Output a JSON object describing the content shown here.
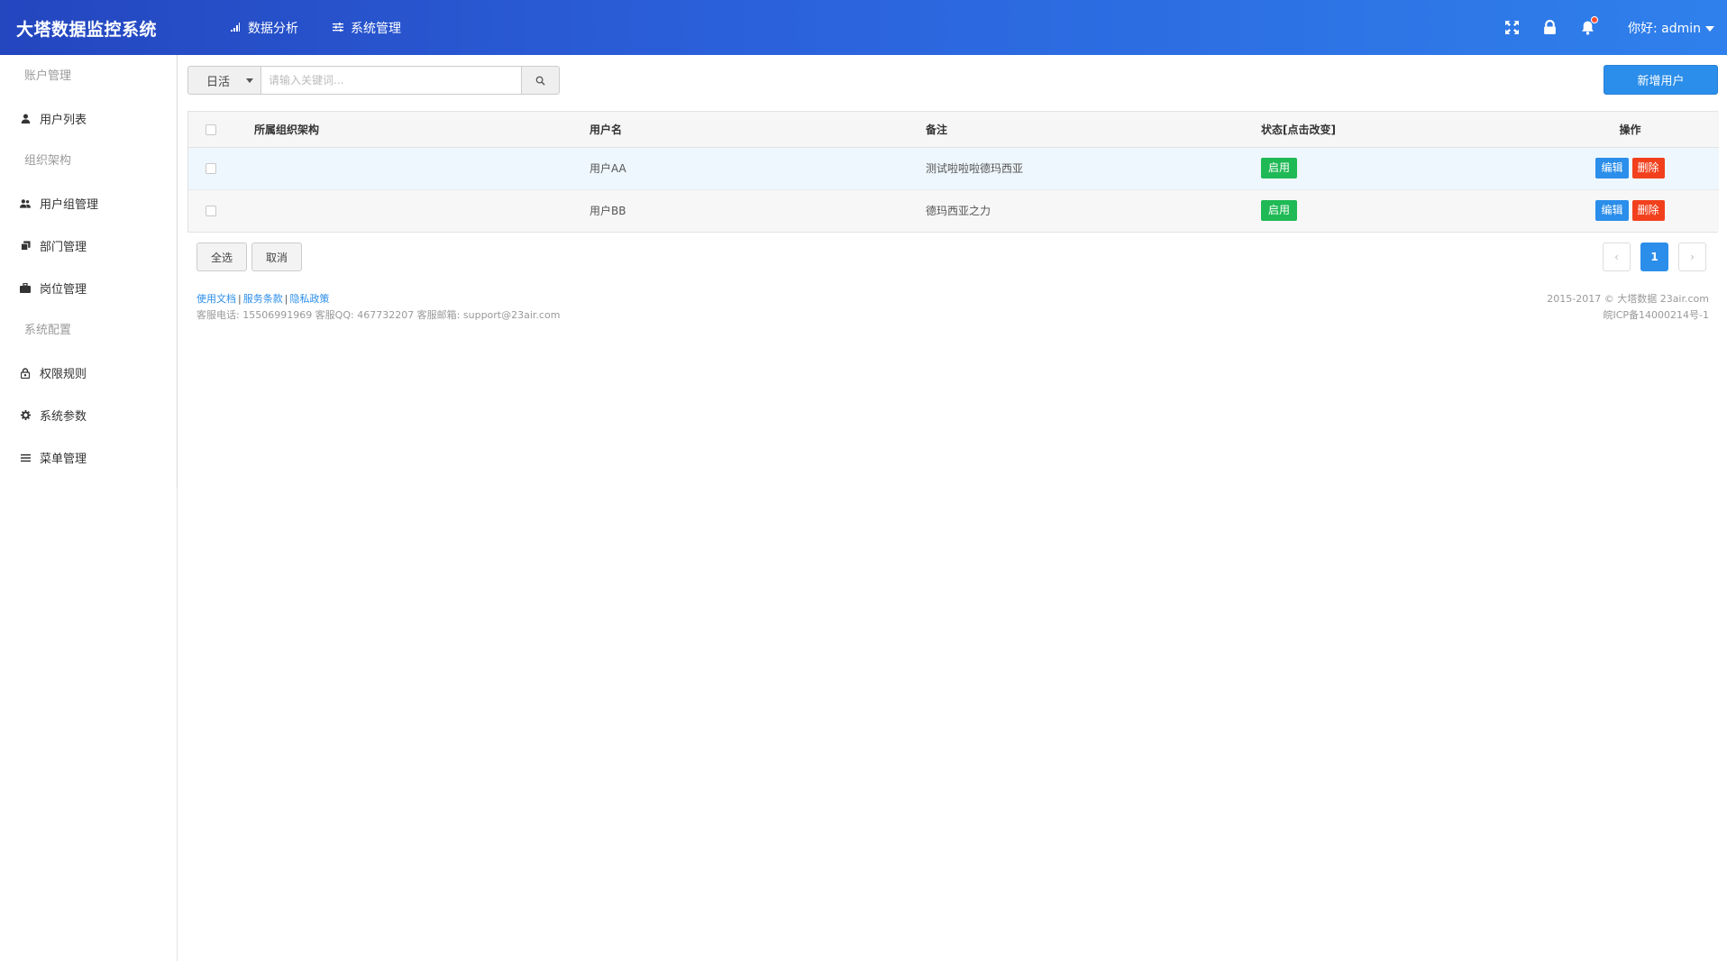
{
  "app": {
    "title": "大塔数据监控系统"
  },
  "topnav": {
    "items": [
      {
        "label": "数据分析",
        "icon": "bar-chart-icon"
      },
      {
        "label": "系统管理",
        "icon": "sliders-icon"
      }
    ]
  },
  "header": {
    "user_greeting": "你好: admin",
    "icons": [
      "fullscreen-icon",
      "lock-icon",
      "bell-icon"
    ],
    "bell_dot_color": "#ff4d2e"
  },
  "sidebar": {
    "groups": [
      {
        "title": "账户管理",
        "items": [
          {
            "label": "用户列表",
            "icon": "user-icon"
          }
        ]
      },
      {
        "title": "组织架构",
        "items": [
          {
            "label": "用户组管理",
            "icon": "users-icon"
          },
          {
            "label": "部门管理",
            "icon": "copy-icon"
          },
          {
            "label": "岗位管理",
            "icon": "briefcase-icon"
          }
        ]
      },
      {
        "title": "系统配置",
        "items": [
          {
            "label": "权限规则",
            "icon": "lock-icon"
          },
          {
            "label": "系统参数",
            "icon": "gear-icon"
          },
          {
            "label": "菜单管理",
            "icon": "menu-icon"
          }
        ]
      }
    ]
  },
  "search": {
    "select_value": "日活",
    "placeholder": "请输入关键词..."
  },
  "toolbar": {
    "add_user_label": "新增用户"
  },
  "table": {
    "columns": [
      "所属组织架构",
      "用户名",
      "备注",
      "状态[点击改变]",
      "操作"
    ],
    "rows": [
      {
        "org": "",
        "username": "用户AA",
        "note": "测试啦啦啦德玛西亚",
        "status": "启用"
      },
      {
        "org": "",
        "username": "用户BB",
        "note": "德玛西亚之力",
        "status": "启用"
      }
    ],
    "edit_label": "编辑",
    "delete_label": "删除"
  },
  "bulk": {
    "select_all_label": "全选",
    "cancel_label": "取消"
  },
  "pagination": {
    "current_page": "1",
    "prev_label": "‹",
    "next_label": "›"
  },
  "footer": {
    "links": [
      "使用文档",
      "服务条款",
      "隐私政策"
    ],
    "contact": "客服电话: 15506991969 客服QQ: 467732207 客服邮箱: support@23air.com",
    "copyright": "2015-2017 © 大塔数据 23air.com",
    "icp": "皖ICP备14000214号-1"
  },
  "colors": {
    "header_gradient_start": "#2446bf",
    "header_gradient_end": "#2f80ec",
    "primary": "#2b8eea",
    "success": "#1fb955",
    "danger": "#f2401d"
  }
}
